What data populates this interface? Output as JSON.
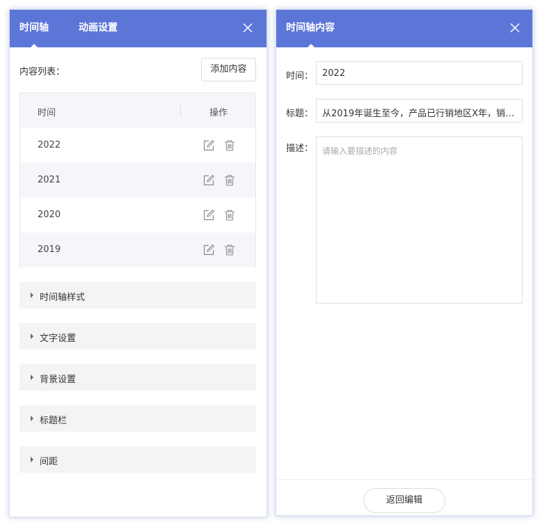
{
  "left_panel": {
    "tabs": [
      {
        "label": "时间轴",
        "active": true
      },
      {
        "label": "动画设置",
        "active": false
      }
    ],
    "content_list_label": "内容列表：",
    "add_button_label": "添加内容",
    "table": {
      "headers": {
        "time": "时间",
        "action": "操作"
      },
      "rows": [
        {
          "time": "2022"
        },
        {
          "time": "2021"
        },
        {
          "time": "2020"
        },
        {
          "time": "2019"
        }
      ]
    },
    "sections": [
      "时间轴样式",
      "文字设置",
      "背景设置",
      "标题栏",
      "间距"
    ]
  },
  "right_panel": {
    "title": "时间轴内容",
    "time_label": "时间：",
    "time_value": "2022",
    "title_label": "标题：",
    "title_value": "从2019年诞生至今，产品已行销地区X年，销…",
    "desc_label": "描述：",
    "desc_placeholder": "请输入要描述的内容",
    "back_button_label": "返回编辑"
  },
  "icons": {
    "close": "close-icon",
    "edit": "edit-icon",
    "delete": "trash-icon",
    "expand": "caret-right-icon"
  },
  "colors": {
    "header_bg": "#5c76d8",
    "header_text": "#ffffff",
    "row_alt_bg": "#f5f6f9",
    "section_bg": "#f4f4f4"
  }
}
